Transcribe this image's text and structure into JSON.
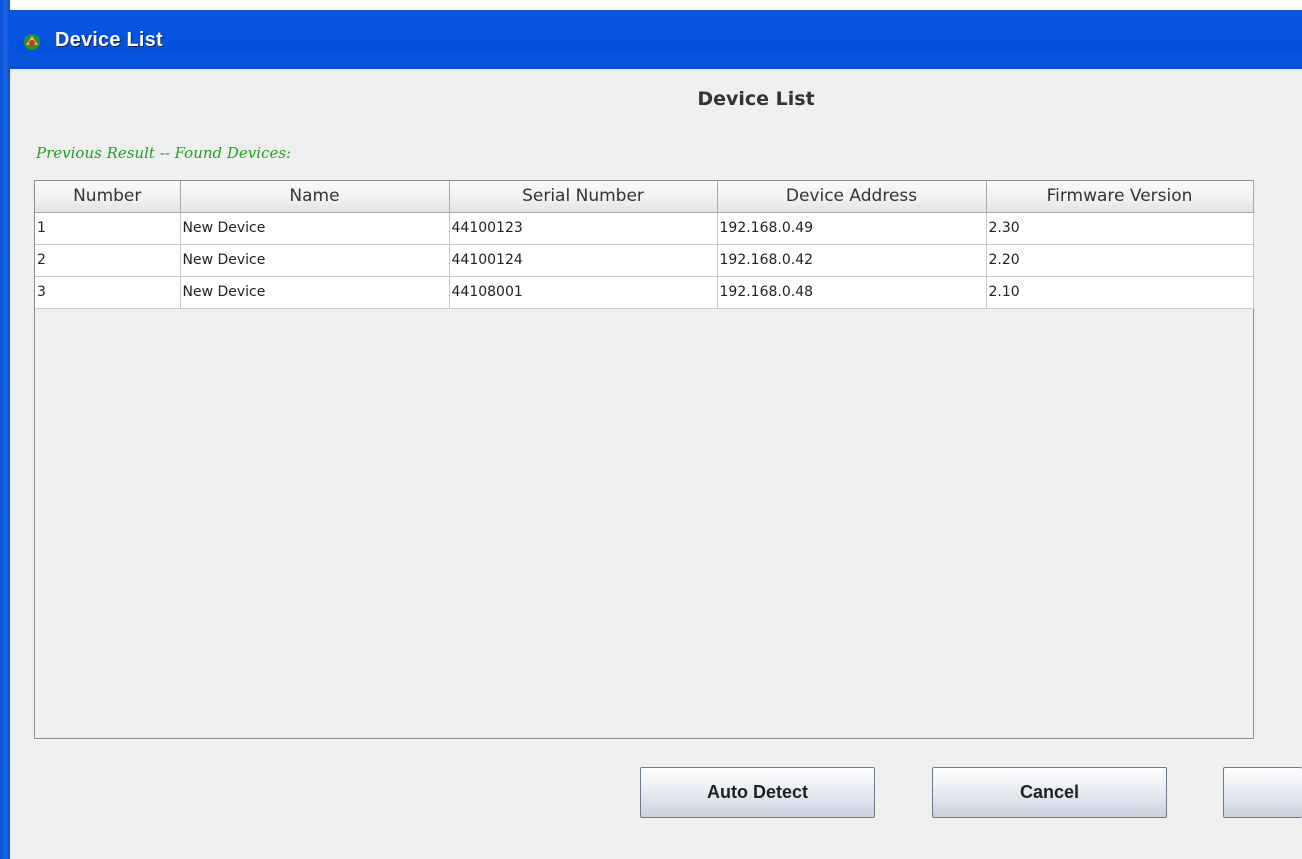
{
  "window": {
    "title": "Device List",
    "icon": "java-app-icon"
  },
  "heading": "Device List",
  "subtitle": "Previous Result -- Found Devices:",
  "table": {
    "columns": [
      "Number",
      "Name",
      "Serial Number",
      "Device Address",
      "Firmware Version"
    ],
    "rows": [
      [
        "1",
        "New Device",
        "44100123",
        "192.168.0.49",
        "2.30"
      ],
      [
        "2",
        "New Device",
        "44100124",
        "192.168.0.42",
        "2.20"
      ],
      [
        "3",
        "New Device",
        "44108001",
        "192.168.0.48",
        "2.10"
      ]
    ]
  },
  "buttons": {
    "auto_detect": "Auto Detect",
    "cancel": "Cancel",
    "third": ""
  },
  "colors": {
    "titlebar": "#0554e0",
    "subtitle": "#22a022",
    "background": "#efefef"
  }
}
